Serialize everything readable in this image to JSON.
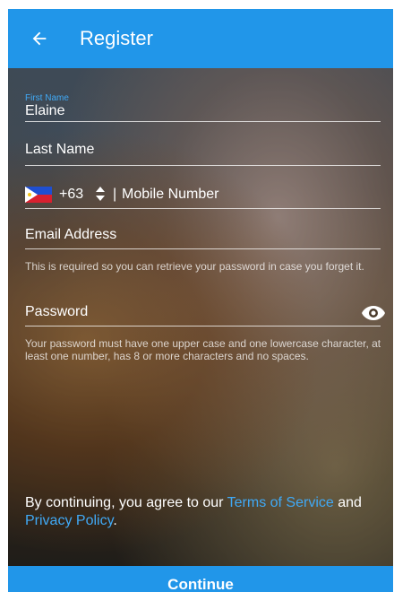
{
  "header": {
    "title": "Register",
    "back_icon": "arrow-left-icon"
  },
  "form": {
    "first_name": {
      "label": "First Name",
      "value": "Elaine"
    },
    "last_name": {
      "placeholder": "Last Name"
    },
    "mobile": {
      "country_flag": "philippines-flag-icon",
      "dial_code": "+63",
      "separator": "|",
      "placeholder": "Mobile Number"
    },
    "email": {
      "placeholder": "Email Address",
      "hint": "This is required so you can retrieve your password in case you forget it."
    },
    "password": {
      "placeholder": "Password",
      "visibility_icon": "eye-icon",
      "hint": "Your password must have one upper case and one lowercase character, at least one number, has 8 or more characters and no spaces."
    }
  },
  "legal": {
    "prefix": "By continuing, you agree to our ",
    "terms_link": "Terms of Service",
    "middle": " and ",
    "privacy_link": "Privacy Policy",
    "suffix": "."
  },
  "footer": {
    "continue_label": "Continue"
  },
  "colors": {
    "primary": "#2196e9",
    "link": "#40a9f5"
  }
}
